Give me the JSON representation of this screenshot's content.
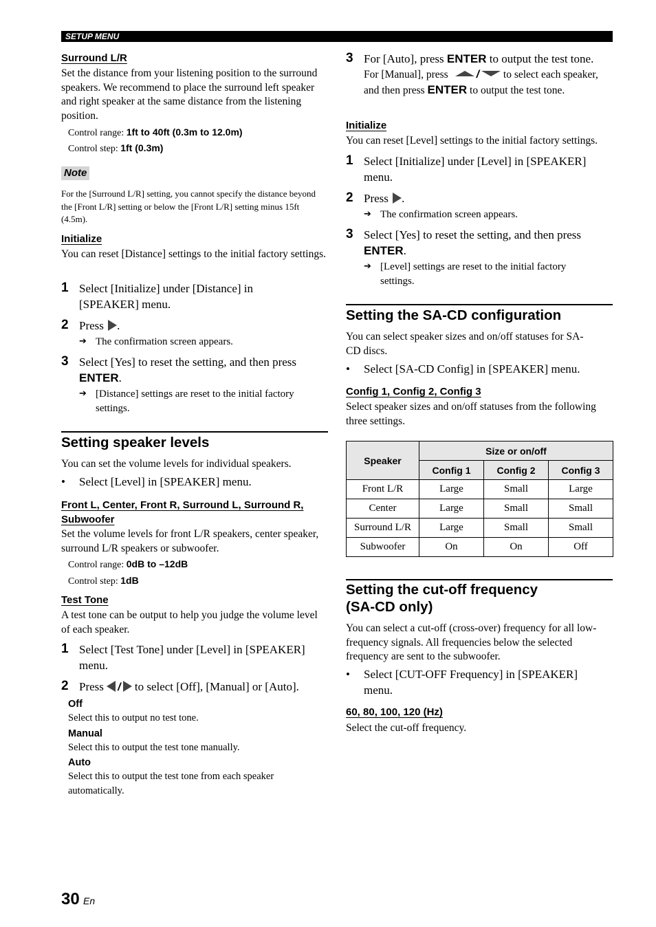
{
  "header": {
    "label": "SETUP MENU"
  },
  "left": {
    "surround": {
      "heading": "Surround L/R",
      "body": "Set the distance from your listening position to the surround speakers. We recommend to place the surround left speaker and right speaker at the same distance from the listening position.",
      "range_label": "Control range: ",
      "range_value": "1ft to 40ft (0.3m to 12.0m)",
      "step_label": "Control step: ",
      "step_value": "1ft (0.3m)"
    },
    "note": {
      "badge": "Note",
      "text": "For the [Surround L/R] setting, you cannot specify the distance beyond the [Front L/R] setting or below the [Front L/R] setting minus 15ft (4.5m)."
    },
    "initialize": {
      "heading": "Initialize",
      "body": "You can reset [Distance] settings to the initial factory settings.",
      "steps": [
        {
          "num": "1",
          "text": "Select [Initialize] under [Distance] in [SPEAKER] menu."
        },
        {
          "num": "2",
          "text_before": "Press ",
          "text_after": ".",
          "result": "The confirmation screen appears."
        },
        {
          "num": "3",
          "text_before": "Select [Yes] to reset the setting, and then press ",
          "key": "ENTER",
          "text_after": ".",
          "result": "[Distance] settings are reset to the initial factory settings."
        }
      ]
    },
    "levels": {
      "title": "Setting speaker levels",
      "intro": "You can set the volume levels for individual speakers.",
      "bullet": "Select [Level] in [SPEAKER] menu.",
      "sub_heading": "Front L, Center, Front R, Surround L, Surround R, Subwoofer",
      "sub_body": "Set the volume levels for front L/R speakers, center speaker, surround L/R speakers or subwoofer.",
      "range_label": "Control range: ",
      "range_value": "0dB to –12dB",
      "step_label": "Control step: ",
      "step_value": "1dB"
    },
    "test_tone": {
      "heading": "Test Tone",
      "body": "A test tone can be output to help you judge the volume level of each speaker.",
      "step1": {
        "num": "1",
        "text": "Select [Test Tone] under [Level] in [SPEAKER] menu."
      },
      "step2": {
        "num": "2",
        "text_before": "Press ",
        "text_after": " to select [Off], [Manual] or [Auto]."
      },
      "options": [
        {
          "label": "Off",
          "desc": "Select this to output no test tone."
        },
        {
          "label": "Manual",
          "desc": "Select this to output the test tone manually."
        },
        {
          "label": "Auto",
          "desc": "Select this to output the test tone from each speaker automatically."
        }
      ]
    }
  },
  "right": {
    "test_tone_step3": {
      "num": "3",
      "line1_before": "For [Auto], press ",
      "key": "ENTER",
      "line1_after": " to output the test tone.",
      "line2_before": "For [Manual], press ",
      "line2_after": " to select each speaker, and then press ",
      "line2_end": " to output the test tone."
    },
    "initialize": {
      "heading": "Initialize",
      "body": "You can reset [Level] settings to the initial factory settings.",
      "steps": [
        {
          "num": "1",
          "text": "Select [Initialize] under [Level] in [SPEAKER] menu."
        },
        {
          "num": "2",
          "text_before": "Press ",
          "text_after": ".",
          "result": "The confirmation screen appears."
        },
        {
          "num": "3",
          "text_before": "Select [Yes] to reset the setting, and then press ",
          "key": "ENTER",
          "text_after": ".",
          "result": "[Level] settings are reset to the initial factory settings."
        }
      ]
    },
    "sacd": {
      "title": "Setting the SA-CD configuration",
      "intro": "You can select speaker sizes and on/off statuses for SA-CD discs.",
      "bullet": "Select [SA-CD Config] in [SPEAKER] menu.",
      "sub_heading": "Config 1, Config 2, Config 3",
      "sub_body": "Select speaker sizes and on/off statuses from the following three settings.",
      "table": {
        "col_speaker": "Speaker",
        "col_group": "Size or on/off",
        "configs": [
          "Config 1",
          "Config 2",
          "Config 3"
        ],
        "rows": [
          {
            "speaker": "Front L/R",
            "values": [
              "Large",
              "Small",
              "Large"
            ]
          },
          {
            "speaker": "Center",
            "values": [
              "Large",
              "Small",
              "Small"
            ]
          },
          {
            "speaker": "Surround L/R",
            "values": [
              "Large",
              "Small",
              "Small"
            ]
          },
          {
            "speaker": "Subwoofer",
            "values": [
              "On",
              "On",
              "Off"
            ]
          }
        ]
      }
    },
    "cutoff": {
      "title_line1": "Setting the cut-off frequency",
      "title_line2": "(SA-CD only)",
      "intro": "You can select a cut-off (cross-over) frequency for all low-frequency signals. All frequencies below the selected frequency are sent to the subwoofer.",
      "bullet": "Select [CUT-OFF Frequency] in [SPEAKER] menu.",
      "sub_heading": "60, 80, 100, 120 (Hz)",
      "sub_body": "Select the cut-off frequency."
    }
  },
  "footer": {
    "page_number": "30",
    "language": "En"
  },
  "icons": {
    "arrow": "➔",
    "bullet": "•"
  }
}
